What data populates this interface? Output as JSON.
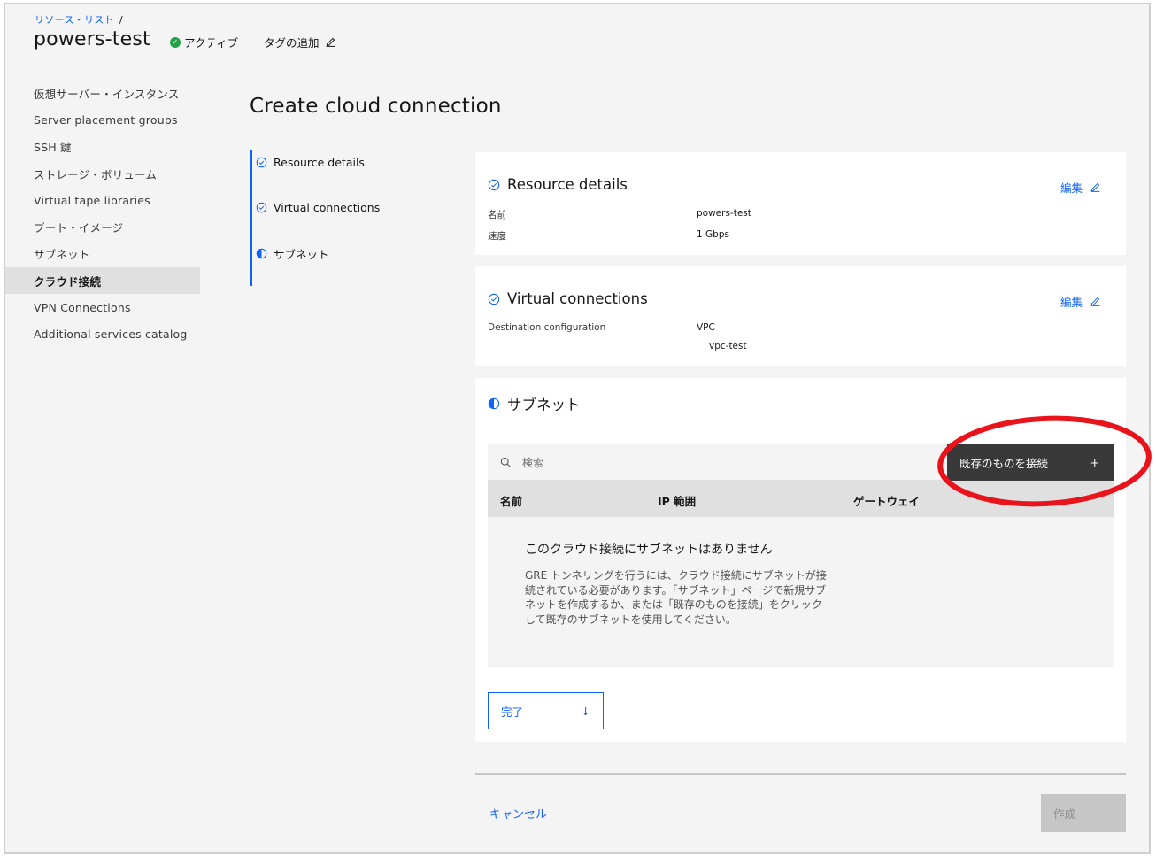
{
  "breadcrumb": {
    "link": "リソース・リスト",
    "separator": "/"
  },
  "resource": {
    "name": "powers-test",
    "status": "アクティブ",
    "add_tag": "タグの追加"
  },
  "sidebar": {
    "items": [
      {
        "label": "仮想サーバー・インスタンス"
      },
      {
        "label": "Server placement groups"
      },
      {
        "label": "SSH 鍵"
      },
      {
        "label": "ストレージ・ボリューム"
      },
      {
        "label": "Virtual tape libraries"
      },
      {
        "label": "ブート・イメージ"
      },
      {
        "label": "サブネット"
      },
      {
        "label": "クラウド接続",
        "active": true
      },
      {
        "label": "VPN Connections"
      },
      {
        "label": "Additional services catalog"
      }
    ]
  },
  "page": {
    "heading": "Create cloud connection"
  },
  "progress": {
    "steps": [
      {
        "label": "Resource details",
        "state": "complete"
      },
      {
        "label": "Virtual connections",
        "state": "complete"
      },
      {
        "label": "サブネット",
        "state": "current"
      }
    ]
  },
  "resource_details": {
    "title": "Resource details",
    "edit_label": "編集",
    "rows": [
      {
        "key": "名前",
        "value": "powers-test"
      },
      {
        "key": "速度",
        "value": "1 Gbps"
      }
    ]
  },
  "virtual_connections": {
    "title": "Virtual connections",
    "edit_label": "編集",
    "key": "Destination configuration",
    "value": "VPC",
    "sub_value": "vpc-test"
  },
  "subnet": {
    "title": "サブネット",
    "search_placeholder": "検索",
    "connect_button": "既存のものを接続",
    "connect_icon": "+",
    "columns": [
      "名前",
      "IP 範囲",
      "ゲートウェイ"
    ],
    "empty_title": "このクラウド接続にサブネットはありません",
    "empty_desc": "GRE トンネリングを行うには、クラウド接続にサブネットが接続されている必要があります。「サブネット」ページで新規サブネットを作成するか、または「既存のものを接続」をクリックして既存のサブネットを使用してください。",
    "done_button": "完了",
    "done_icon": "↓"
  },
  "footer": {
    "cancel": "キャンセル",
    "create": "作成"
  },
  "colors": {
    "accent": "#0f62fe",
    "success": "#24a148",
    "annotation": "#e8131b"
  },
  "icons": [
    "checkmark-icon",
    "edit-icon",
    "search-icon",
    "half-circle-icon",
    "plus-icon",
    "arrow-down-icon"
  ]
}
